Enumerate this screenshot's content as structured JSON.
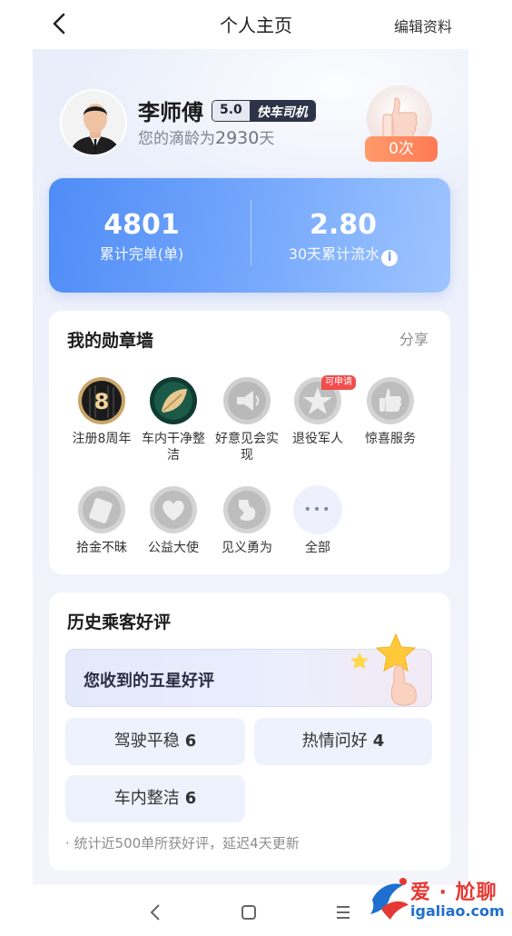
{
  "header": {
    "title": "个人主页",
    "edit_label": "编辑资料"
  },
  "profile": {
    "name": "李师傅",
    "rating": "5.0",
    "driver_type": "快车司机",
    "seniority_prefix": "您的滴龄为",
    "seniority_days": "2930",
    "seniority_suffix": "天",
    "likes": "0次"
  },
  "stats": {
    "orders_value": "4801",
    "orders_label": "累计完单(单)",
    "revenue_value": "2.80",
    "revenue_label": "30天累计流水",
    "info_glyph": "i"
  },
  "medals": {
    "title": "我的勋章墙",
    "share_label": "分享",
    "apply_tag": "可申请",
    "more_glyph": "•••",
    "items": [
      {
        "label": "注册8周年",
        "icon": "eight-year-badge-icon"
      },
      {
        "label": "车内干净整洁",
        "icon": "leaf-badge-icon"
      },
      {
        "label": "好意见会实现",
        "icon": "megaphone-badge-icon"
      },
      {
        "label": "退役军人",
        "icon": "star-badge-icon"
      },
      {
        "label": "惊喜服务",
        "icon": "thumb-badge-icon"
      },
      {
        "label": "拾金不昧",
        "icon": "wallet-badge-icon"
      },
      {
        "label": "公益大使",
        "icon": "heart-badge-icon"
      },
      {
        "label": "见义勇为",
        "icon": "arm-badge-icon"
      },
      {
        "label": "全部",
        "icon": "more-icon"
      }
    ]
  },
  "reviews": {
    "title": "历史乘客好评",
    "five_star_label": "您收到的五星好评",
    "tags": [
      {
        "label": "驾驶平稳",
        "count": "6"
      },
      {
        "label": "热情问好",
        "count": "4"
      },
      {
        "label": "车内整洁",
        "count": "6"
      }
    ],
    "note": "· 统计近500单所获好评，延迟4天更新"
  },
  "watermark": {
    "line1": "爱 · 尬聊",
    "line2": "igaliao.com"
  },
  "colors": {
    "stats_gradient_start": "#4f8cf7",
    "stats_gradient_end": "#9fc5ff",
    "apply_tag": "#f24c4c",
    "likes_pill": "#ff7a55"
  }
}
